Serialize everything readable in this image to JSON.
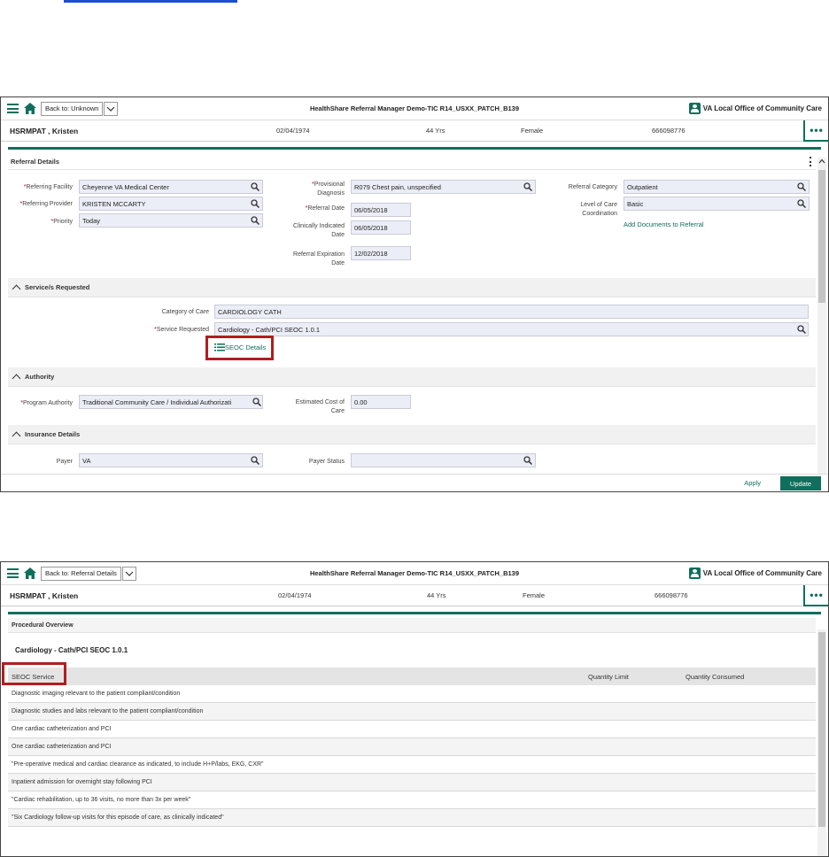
{
  "header": {
    "app_title": "HealthShare Referral Manager Demo-TIC R14_USXX_PATCH_B139",
    "office": "VA Local Office of Community Care",
    "more": "•••",
    "accent": "#0f6f5c"
  },
  "patient": {
    "name": "HSRMPAT , Kristen",
    "dob": "02/04/1974",
    "age": "44 Yrs",
    "sex": "Female",
    "id": "666098776"
  },
  "screen1": {
    "back_label": "Back to: Unknown",
    "section_title": "Referral Details",
    "fields": {
      "referring_facility_label": "Referring Facility",
      "referring_facility": "Cheyenne VA Medical Center",
      "referring_provider_label": "Referring Provider",
      "referring_provider": "KRISTEN MCCARTY",
      "priority_label": "Priority",
      "priority": "Today",
      "provisional_diagnosis_label_1": "Provisional",
      "provisional_diagnosis_label_2": "Diagnosis",
      "provisional_diagnosis": "R079 Chest pain, unspecified",
      "referral_date_label": "Referral Date",
      "referral_date": "06/05/2018",
      "clinically_indicated_label_1": "Clinically Indicated",
      "clinically_indicated_label_2": "Date",
      "clinically_indicated_date": "06/05/2018",
      "expiration_label_1": "Referral Expiration",
      "expiration_label_2": "Date",
      "expiration_date": "12/02/2018",
      "referral_category_label": "Referral Category",
      "referral_category": "Outpatient",
      "level_of_care_label_1": "Level of Care",
      "level_of_care_label_2": "Coordination",
      "level_of_care": "Basic",
      "add_documents": "Add Documents to Referral"
    },
    "services": {
      "title": "Service/s Requested",
      "category_label": "Category of Care",
      "category": "CARDIOLOGY CATH",
      "service_label": "Service Requested",
      "service": "Cardiology - Cath/PCI SEOC 1.0.1",
      "seoc_details": "SEOC Details"
    },
    "authority": {
      "title": "Authority",
      "program_label": "Program Authority",
      "program": "Traditional Community Care / Individual Authorizati",
      "cost_label_1": "Estimated Cost of",
      "cost_label_2": "Care",
      "cost": "0.00"
    },
    "insurance": {
      "title": "Insurance Details",
      "payer_label": "Payer",
      "payer": "VA",
      "payer_status_label": "Payer Status",
      "payer_status": ""
    },
    "footer": {
      "apply": "Apply",
      "update": "Update"
    }
  },
  "screen2": {
    "back_label": "Back to: Referral Details",
    "section_title": "Procedural Overview",
    "seoc_title": "Cardiology - Cath/PCI SEOC 1.0.1",
    "columns": [
      "SEOC Service",
      "Quantity Limit",
      "Quantity Consumed"
    ],
    "rows": [
      "Diagnostic imaging relevant to the patient compliant/condition",
      "Diagnostic studies and labs relevant to the patient compliant/condition",
      "One cardiac catheterization and PCI",
      "One cardiac catheterization and PCI",
      "\"Pre-operative medical and cardiac clearance as indicated, to include H+P/labs, EKG, CXR\"",
      "Inpatient admission for overnight stay following PCI",
      "\"Cardiac rehabilitation, up to 36 visits, no more than 3x per week\"",
      "\"Six Cardiology follow-up visits for this episode of care, as clinically indicated\""
    ]
  }
}
